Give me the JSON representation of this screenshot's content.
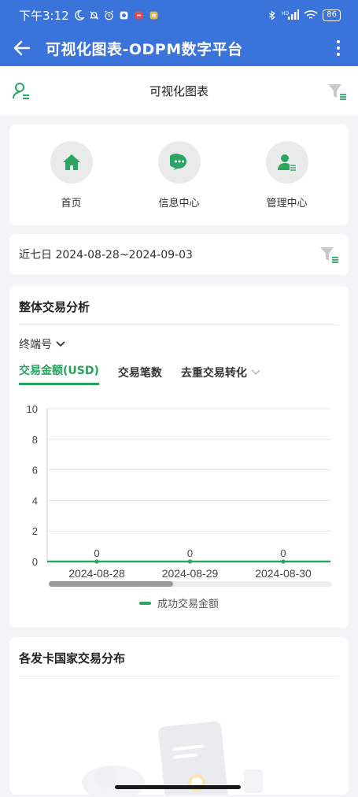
{
  "status_bar": {
    "time": "下午3:12",
    "battery": "86"
  },
  "app_bar": {
    "title": "可视化图表-ODPM数字平台"
  },
  "subheader": {
    "title": "可视化图表"
  },
  "nav": {
    "items": [
      {
        "label": "首页",
        "icon": "home-icon"
      },
      {
        "label": "信息中心",
        "icon": "chat-icon"
      },
      {
        "label": "管理中心",
        "icon": "manage-icon"
      }
    ]
  },
  "date_filter": {
    "text": "近七日 2024-08-28~2024-09-03"
  },
  "analysis": {
    "title": "整体交易分析",
    "terminal_label": "终端号",
    "tabs": [
      {
        "label": "交易金额(USD)",
        "active": true
      },
      {
        "label": "交易笔数",
        "active": false
      },
      {
        "label": "去重交易转化",
        "active": false
      }
    ],
    "legend": "成功交易金额"
  },
  "chart_data": {
    "type": "line",
    "x": [
      "2024-08-28",
      "2024-08-29",
      "2024-08-30"
    ],
    "series": [
      {
        "name": "成功交易金额",
        "values": [
          0,
          0,
          0
        ]
      }
    ],
    "yticks": [
      "0",
      "2",
      "4",
      "6",
      "8",
      "10"
    ],
    "ylim": [
      0,
      10
    ],
    "grid": true,
    "legend_position": "bottom",
    "color": "#2aa562",
    "data_labels": [
      "0",
      "0",
      "0"
    ]
  },
  "distribution": {
    "title": "各发卡国家交易分布"
  },
  "colors": {
    "primary": "#3a73d9",
    "accent": "#24a35a"
  }
}
